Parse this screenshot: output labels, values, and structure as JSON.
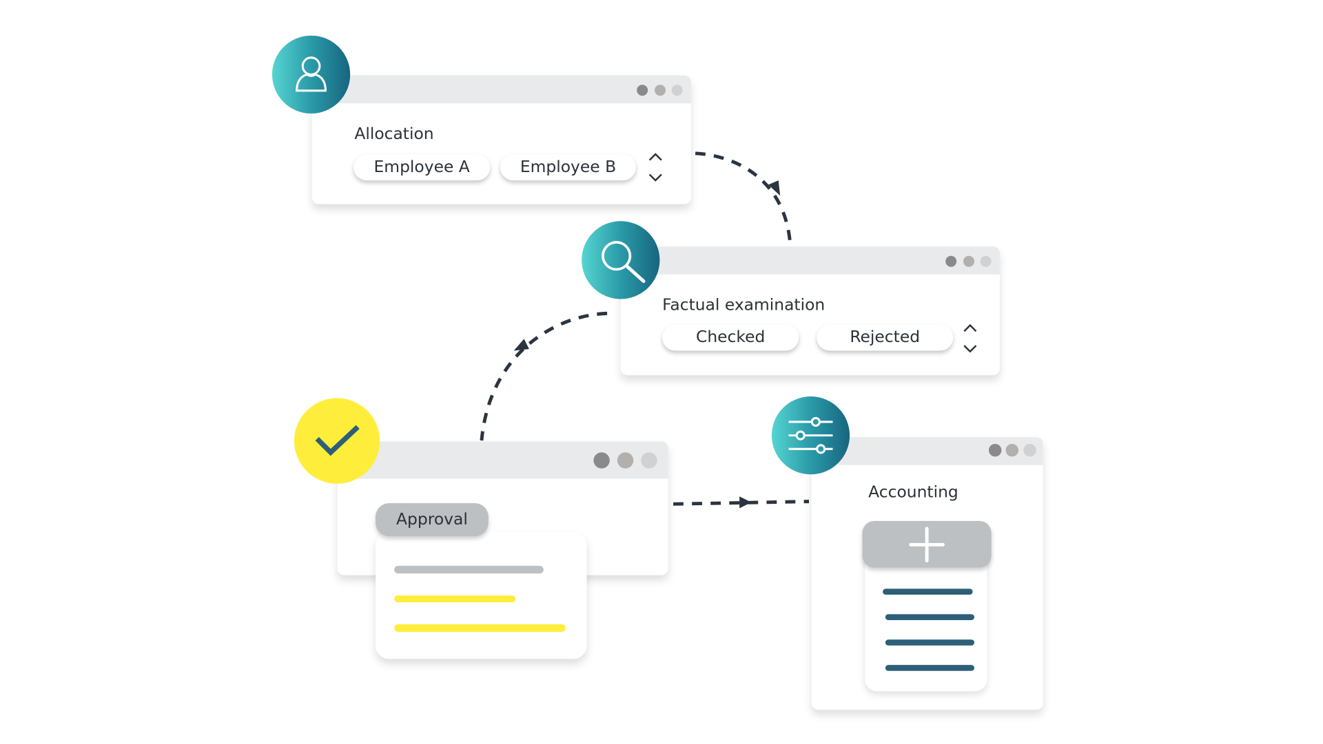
{
  "colors": {
    "teal_start": "#56d5d1",
    "teal_end": "#17657f",
    "yellow": "#ffed3b",
    "navy": "#2d5f78",
    "arrow": "#2b3440",
    "gray_pill": "#bcc0c3"
  },
  "steps": [
    {
      "title": "Allocation",
      "icon": "user-icon",
      "options": [
        "Employee A",
        "Employee B"
      ]
    },
    {
      "title": "Factual examination",
      "icon": "magnifier-icon",
      "options": [
        "Checked",
        "Rejected"
      ]
    },
    {
      "title": "Approval",
      "icon": "checkmark-icon"
    },
    {
      "title": "Accounting",
      "icon": "sliders-icon",
      "button_icon": "plus-icon"
    }
  ]
}
